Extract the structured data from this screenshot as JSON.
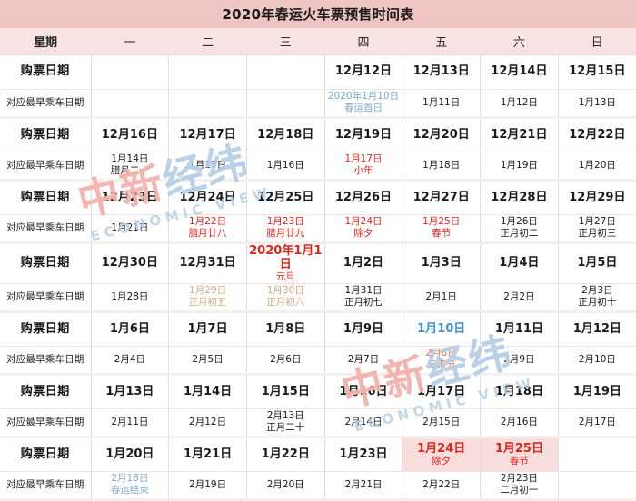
{
  "title": "2020年春运火车票预售时间表",
  "colors": {
    "title_bar": "#eec5c2",
    "header_row": "#f7e4e2",
    "highlight_pink": "#f7dedd",
    "red": "#e2231a",
    "blue": "#7fa9cf",
    "tan": "#d9a87a",
    "orange": "#e06a40"
  },
  "weekday_header": {
    "label": "星期",
    "days": [
      "一",
      "二",
      "三",
      "四",
      "五",
      "六",
      "日"
    ]
  },
  "row_labels": {
    "buy": "购票日期",
    "ride": "对应最早乘车日期"
  },
  "watermark": {
    "cn_red": "中新",
    "cn_blue": "经纬",
    "en": "ECONOMIC VIEW"
  },
  "weeks": [
    {
      "buy": [
        {
          "main": "",
          "sub": "",
          "color": "black"
        },
        {
          "main": "",
          "sub": "",
          "color": "black"
        },
        {
          "main": "",
          "sub": "",
          "color": "black"
        },
        {
          "main": "12月12日",
          "sub": "",
          "color": "black"
        },
        {
          "main": "12月13日",
          "sub": "",
          "color": "black"
        },
        {
          "main": "12月14日",
          "sub": "",
          "color": "black"
        },
        {
          "main": "12月15日",
          "sub": "",
          "color": "black"
        }
      ],
      "ride": [
        {
          "main": "",
          "sub": "",
          "color": "black"
        },
        {
          "main": "",
          "sub": "",
          "color": "black"
        },
        {
          "main": "",
          "sub": "",
          "color": "black"
        },
        {
          "main": "2020年1月10日",
          "sub": "春运首日",
          "color": "blue"
        },
        {
          "main": "1月11日",
          "sub": "",
          "color": "black"
        },
        {
          "main": "1月12日",
          "sub": "",
          "color": "black"
        },
        {
          "main": "1月13日",
          "sub": "",
          "color": "black"
        }
      ]
    },
    {
      "buy": [
        {
          "main": "12月16日",
          "sub": "",
          "color": "black"
        },
        {
          "main": "12月17日",
          "sub": "",
          "color": "black"
        },
        {
          "main": "12月18日",
          "sub": "",
          "color": "black"
        },
        {
          "main": "12月19日",
          "sub": "",
          "color": "black"
        },
        {
          "main": "12月20日",
          "sub": "",
          "color": "black"
        },
        {
          "main": "12月21日",
          "sub": "",
          "color": "black"
        },
        {
          "main": "12月22日",
          "sub": "",
          "color": "black"
        }
      ],
      "ride": [
        {
          "main": "1月14日",
          "sub": "腊月二十",
          "color": "black"
        },
        {
          "main": "1月15日",
          "sub": "",
          "color": "black"
        },
        {
          "main": "1月16日",
          "sub": "",
          "color": "black"
        },
        {
          "main": "1月17日",
          "sub": "小年",
          "color": "red"
        },
        {
          "main": "1月18日",
          "sub": "",
          "color": "black"
        },
        {
          "main": "1月19日",
          "sub": "",
          "color": "black"
        },
        {
          "main": "1月20日",
          "sub": "",
          "color": "black"
        }
      ]
    },
    {
      "buy": [
        {
          "main": "12月23日",
          "sub": "",
          "color": "black"
        },
        {
          "main": "12月24日",
          "sub": "",
          "color": "black"
        },
        {
          "main": "12月25日",
          "sub": "",
          "color": "black"
        },
        {
          "main": "12月26日",
          "sub": "",
          "color": "black"
        },
        {
          "main": "12月27日",
          "sub": "",
          "color": "black"
        },
        {
          "main": "12月28日",
          "sub": "",
          "color": "black"
        },
        {
          "main": "12月29日",
          "sub": "",
          "color": "black"
        }
      ],
      "ride": [
        {
          "main": "1月21日",
          "sub": "",
          "color": "black"
        },
        {
          "main": "1月22日",
          "sub": "腊月廿八",
          "color": "red"
        },
        {
          "main": "1月23日",
          "sub": "腊月廿九",
          "color": "red"
        },
        {
          "main": "1月24日",
          "sub": "除夕",
          "color": "red"
        },
        {
          "main": "1月25日",
          "sub": "春节",
          "color": "red"
        },
        {
          "main": "1月26日",
          "sub": "正月初二",
          "color": "black"
        },
        {
          "main": "1月27日",
          "sub": "正月初三",
          "color": "black"
        }
      ]
    },
    {
      "buy": [
        {
          "main": "12月30日",
          "sub": "",
          "color": "black"
        },
        {
          "main": "12月31日",
          "sub": "",
          "color": "black"
        },
        {
          "main": "2020年1月1日",
          "sub": "元旦",
          "color": "red"
        },
        {
          "main": "1月2日",
          "sub": "",
          "color": "black"
        },
        {
          "main": "1月3日",
          "sub": "",
          "color": "black"
        },
        {
          "main": "1月4日",
          "sub": "",
          "color": "black"
        },
        {
          "main": "1月5日",
          "sub": "",
          "color": "black"
        }
      ],
      "ride": [
        {
          "main": "1月28日",
          "sub": "",
          "color": "black"
        },
        {
          "main": "1月29日",
          "sub": "正月初五",
          "color": "tan"
        },
        {
          "main": "1月30日",
          "sub": "正月初六",
          "color": "tan"
        },
        {
          "main": "1月31日",
          "sub": "正月初七",
          "color": "black"
        },
        {
          "main": "2月1日",
          "sub": "",
          "color": "black"
        },
        {
          "main": "2月2日",
          "sub": "",
          "color": "black"
        },
        {
          "main": "2月3日",
          "sub": "正月初十",
          "color": "black"
        }
      ]
    },
    {
      "buy": [
        {
          "main": "1月6日",
          "sub": "",
          "color": "black"
        },
        {
          "main": "1月7日",
          "sub": "",
          "color": "black"
        },
        {
          "main": "1月8日",
          "sub": "",
          "color": "black"
        },
        {
          "main": "1月9日",
          "sub": "",
          "color": "black"
        },
        {
          "main": "1月10日",
          "sub": "",
          "color": "blue2"
        },
        {
          "main": "1月11日",
          "sub": "",
          "color": "black"
        },
        {
          "main": "1月12日",
          "sub": "",
          "color": "black"
        }
      ],
      "ride": [
        {
          "main": "2月4日",
          "sub": "",
          "color": "black"
        },
        {
          "main": "2月5日",
          "sub": "",
          "color": "black"
        },
        {
          "main": "2月6日",
          "sub": "",
          "color": "black"
        },
        {
          "main": "2月7日",
          "sub": "",
          "color": "black"
        },
        {
          "main": "2月8日",
          "sub": "元宵节",
          "color": "orange"
        },
        {
          "main": "2月9日",
          "sub": "",
          "color": "black"
        },
        {
          "main": "2月10日",
          "sub": "",
          "color": "black"
        }
      ]
    },
    {
      "buy": [
        {
          "main": "1月13日",
          "sub": "",
          "color": "black"
        },
        {
          "main": "1月14日",
          "sub": "",
          "color": "black"
        },
        {
          "main": "1月15日",
          "sub": "",
          "color": "black"
        },
        {
          "main": "1月16日",
          "sub": "",
          "color": "black"
        },
        {
          "main": "1月17日",
          "sub": "",
          "color": "black"
        },
        {
          "main": "1月18日",
          "sub": "",
          "color": "black"
        },
        {
          "main": "1月19日",
          "sub": "",
          "color": "black"
        }
      ],
      "ride": [
        {
          "main": "2月11日",
          "sub": "",
          "color": "black"
        },
        {
          "main": "2月12日",
          "sub": "",
          "color": "black"
        },
        {
          "main": "2月13日",
          "sub": "正月二十",
          "color": "black"
        },
        {
          "main": "2月14日",
          "sub": "",
          "color": "black"
        },
        {
          "main": "2月15日",
          "sub": "",
          "color": "black"
        },
        {
          "main": "2月16日",
          "sub": "",
          "color": "black"
        },
        {
          "main": "2月17日",
          "sub": "",
          "color": "black"
        }
      ]
    },
    {
      "buy": [
        {
          "main": "1月20日",
          "sub": "",
          "color": "black"
        },
        {
          "main": "1月21日",
          "sub": "",
          "color": "black"
        },
        {
          "main": "1月22日",
          "sub": "",
          "color": "black"
        },
        {
          "main": "1月23日",
          "sub": "",
          "color": "black"
        },
        {
          "main": "1月24日",
          "sub": "除夕",
          "color": "red",
          "highlight": true
        },
        {
          "main": "1月25日",
          "sub": "春节",
          "color": "red",
          "highlight": true
        },
        {
          "main": "",
          "sub": "",
          "color": "black"
        }
      ],
      "ride": [
        {
          "main": "2月18日",
          "sub": "春运结束",
          "color": "blue"
        },
        {
          "main": "2月19日",
          "sub": "",
          "color": "black"
        },
        {
          "main": "2月20日",
          "sub": "",
          "color": "black"
        },
        {
          "main": "2月21日",
          "sub": "",
          "color": "black"
        },
        {
          "main": "2月22日",
          "sub": "",
          "color": "black"
        },
        {
          "main": "2月23日",
          "sub": "二月初一",
          "color": "black"
        },
        {
          "main": "",
          "sub": "",
          "color": "black"
        }
      ]
    }
  ]
}
